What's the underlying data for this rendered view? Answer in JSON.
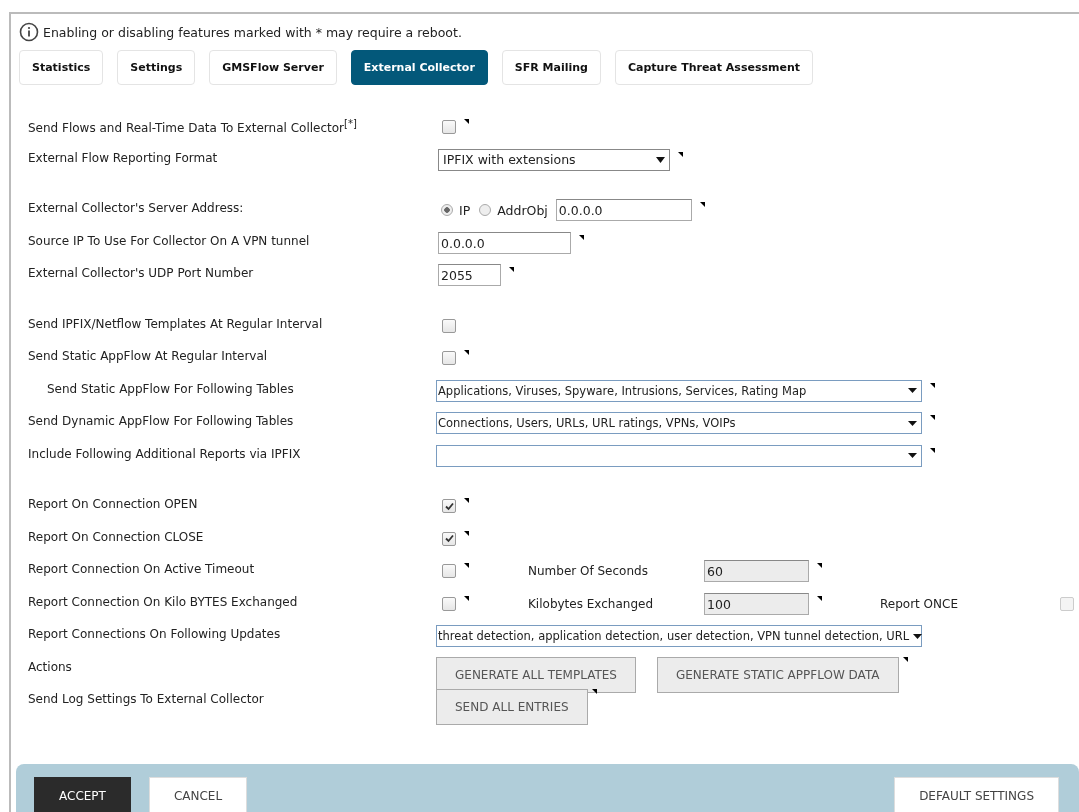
{
  "notice": {
    "text": "Enabling or disabling features marked with * may require a reboot."
  },
  "tabs": [
    {
      "label": "Statistics",
      "selected": false
    },
    {
      "label": "Settings",
      "selected": false
    },
    {
      "label": "GMSFlow Server",
      "selected": false
    },
    {
      "label": "External Collector",
      "selected": true
    },
    {
      "label": "SFR Mailing",
      "selected": false
    },
    {
      "label": "Capture Threat Assessment",
      "selected": false
    }
  ],
  "sections": [
    [
      {
        "kind": "checkbox",
        "label": "Send Flows and Real-Time Data To External Collector",
        "note": "[*]",
        "checked": false,
        "tip": true
      },
      {
        "kind": "select",
        "label": "External Flow Reporting Format",
        "value": "IPFIX with extensions",
        "tip": true
      }
    ],
    [
      {
        "kind": "address",
        "label": "External Collector's Server Address:",
        "options": [
          {
            "label": "IP",
            "selected": true
          },
          {
            "label": "AddrObj",
            "selected": false
          }
        ],
        "value": "0.0.0.0",
        "tip": true
      },
      {
        "kind": "input",
        "label": "Source IP To Use For Collector On A VPN tunnel",
        "value": "0.0.0.0",
        "tip": true
      },
      {
        "kind": "port",
        "label": "External Collector's UDP Port Number",
        "value": "2055",
        "tip": true
      }
    ],
    [
      {
        "kind": "checkbox",
        "label": "Send IPFIX/Netflow Templates At Regular Interval",
        "checked": false
      },
      {
        "kind": "checkbox",
        "label": "Send Static AppFlow At Regular Interval",
        "checked": false,
        "tip": true,
        "children": [
          {
            "kind": "multiselect",
            "label": "Send Static AppFlow For Following Tables",
            "value": "Applications, Viruses, Spyware, Intrusions, Services, Rating Map",
            "tip": true
          }
        ]
      },
      {
        "kind": "multiselect",
        "label": "Send Dynamic AppFlow For Following Tables",
        "value": "Connections, Users, URLs, URL ratings, VPNs, VOIPs",
        "tip": true
      },
      {
        "kind": "multiselect",
        "label": "Include Following Additional Reports via IPFIX",
        "tip": true
      }
    ],
    [
      {
        "kind": "checkbox",
        "label": "Report On Connection OPEN",
        "checked": true,
        "tip": true
      },
      {
        "kind": "checkbox",
        "label": "Report On Connection CLOSE",
        "checked": true,
        "tip": true
      },
      {
        "kind": "checkfield",
        "label": "Report Connection On Active Timeout",
        "checked": false,
        "tip": true,
        "field_label": "Number Of Seconds",
        "field_value": "60",
        "field_disabled": true,
        "field_tip": true
      },
      {
        "kind": "checkfield",
        "label": "Report Connection On Kilo BYTES Exchanged",
        "checked": false,
        "tip": true,
        "field_label": "Kilobytes Exchanged",
        "field_value": "100",
        "field_disabled": true,
        "field_tip": true,
        "extra_label": "Report ONCE",
        "extra_checked": false,
        "extra_disabled": true
      },
      {
        "kind": "multiselect",
        "label": "Report Connections On Following Updates",
        "value": "threat detection, application detection, user detection, VPN tunnel detection, URL"
      },
      {
        "kind": "buttons",
        "label": "Actions",
        "buttons": [
          {
            "label": "GENERATE ALL TEMPLATES"
          },
          {
            "label": "GENERATE STATIC APPFLOW DATA",
            "tip": true
          }
        ]
      },
      {
        "kind": "buttons",
        "label": "Send Log Settings To External Collector",
        "buttons": [
          {
            "label": "SEND ALL ENTRIES",
            "tip": true
          }
        ]
      }
    ]
  ],
  "footer": {
    "accept": "ACCEPT",
    "cancel": "CANCEL",
    "defaults": "DEFAULT SETTINGS"
  }
}
